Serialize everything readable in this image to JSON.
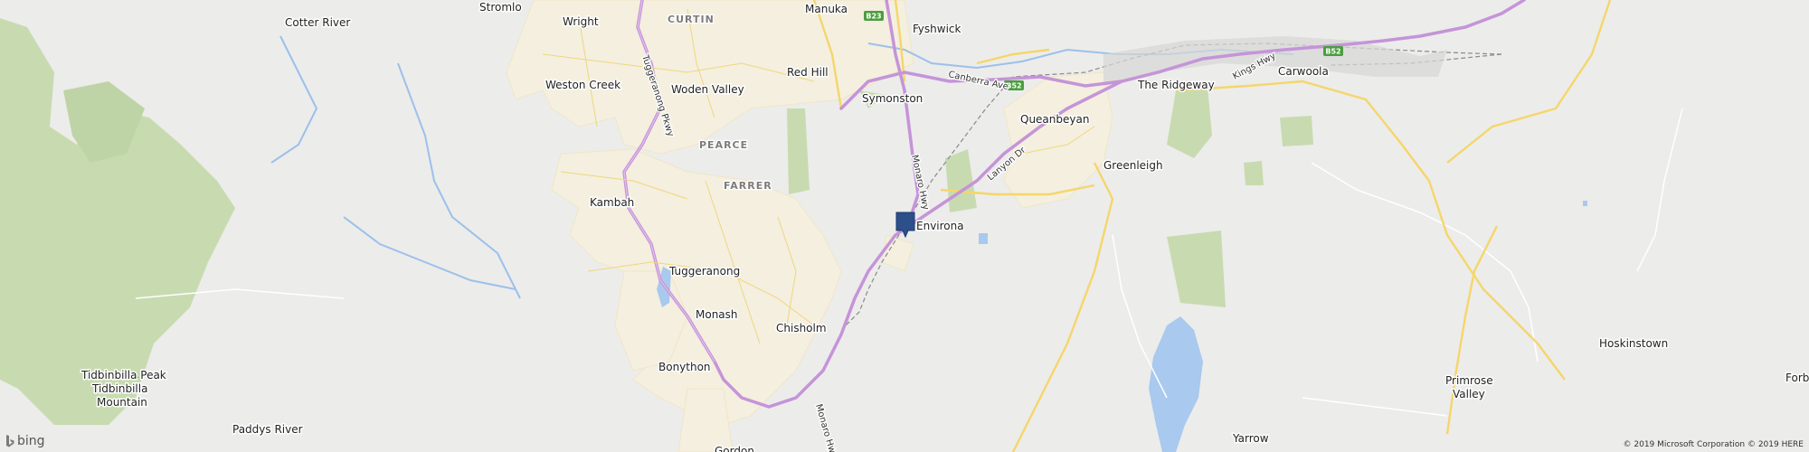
{
  "map": {
    "places": [
      {
        "text": "Cotter River"
      },
      {
        "text": "Stromlo"
      },
      {
        "text": "Wright"
      },
      {
        "text": "Manuka"
      },
      {
        "text": "Fyshwick"
      },
      {
        "text": "Weston Creek"
      },
      {
        "text": "Woden Valley"
      },
      {
        "text": "Red Hill"
      },
      {
        "text": "Symonston"
      },
      {
        "text": "Queanbeyan"
      },
      {
        "text": "The Ridgeway"
      },
      {
        "text": "Carwoola"
      },
      {
        "text": "Greenleigh"
      },
      {
        "text": "Kambah"
      },
      {
        "text": "Environa"
      },
      {
        "text": "Tuggeranong"
      },
      {
        "text": "Monash"
      },
      {
        "text": "Chisholm"
      },
      {
        "text": "Bonython"
      },
      {
        "text": "Tidbinbilla Peak"
      },
      {
        "text": "Tidbinbilla"
      },
      {
        "text": "Mountain"
      },
      {
        "text": "Paddys River"
      },
      {
        "text": "Yarrow"
      },
      {
        "text": "Hoskinstown"
      },
      {
        "text": "Primrose"
      },
      {
        "text": "Valley"
      },
      {
        "text": "Forb"
      },
      {
        "text": "Gordon"
      }
    ],
    "suburbs": [
      {
        "text": "CURTIN"
      },
      {
        "text": "PEARCE"
      },
      {
        "text": "FARRER"
      }
    ],
    "roads": [
      {
        "text": "Tuggeranong Pkwy"
      },
      {
        "text": "Monaro Hwy"
      },
      {
        "text": "Canberra Ave"
      },
      {
        "text": "Lanyon Dr"
      },
      {
        "text": "Kings Hwy"
      },
      {
        "text": "Monaro Hwy"
      }
    ],
    "shields": [
      {
        "text": "B23"
      },
      {
        "text": "B52"
      },
      {
        "text": "B52"
      }
    ],
    "pin": {
      "icon": "location-pin-icon",
      "color": "#2d4f8a"
    },
    "colors": {
      "land": "#ececeb",
      "urban": "#f3eedd",
      "park": "#c8dbb0",
      "water": "#a9c9ee",
      "highway": "#c594d8",
      "major_road": "#f5d66a",
      "rail": "#888888"
    }
  },
  "branding": {
    "logo_text": "bing",
    "logo_icon": "bing-logo-icon"
  },
  "attribution": "© 2019 Microsoft Corporation © 2019 HERE"
}
